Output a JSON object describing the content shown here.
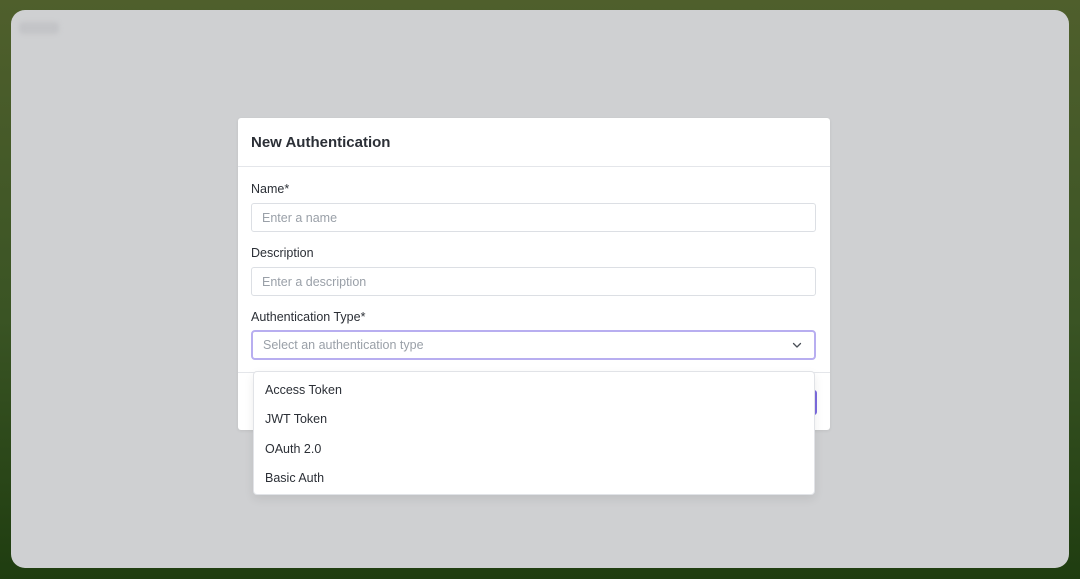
{
  "dialog": {
    "title": "New Authentication",
    "name_field": {
      "label": "Name*",
      "placeholder": "Enter a name",
      "value": ""
    },
    "description_field": {
      "label": "Description",
      "placeholder": "Enter a description",
      "value": ""
    },
    "auth_type_field": {
      "label": "Authentication Type*",
      "placeholder": "Select an authentication type",
      "options": [
        "Access Token",
        "JWT Token",
        "OAuth 2.0",
        "Basic Auth"
      ],
      "focus_color": "#b8aef0"
    },
    "accent_color": "#7c6be0"
  }
}
